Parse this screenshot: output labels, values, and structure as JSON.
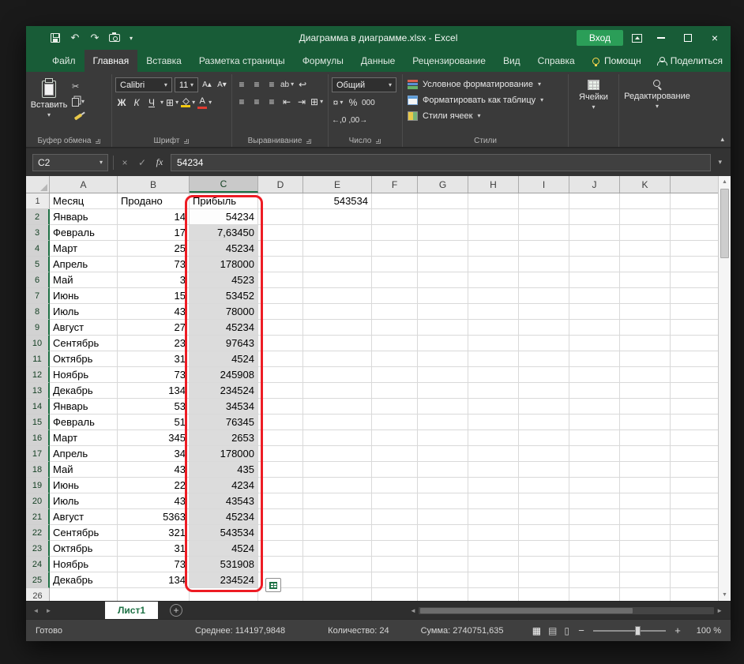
{
  "window": {
    "title": "Диаграмма в диаграмме.xlsx  -  Excel",
    "sign_in": "Вход"
  },
  "tabs": [
    {
      "label": "Файл",
      "active": false
    },
    {
      "label": "Главная",
      "active": true
    },
    {
      "label": "Вставка",
      "active": false
    },
    {
      "label": "Разметка страницы",
      "active": false
    },
    {
      "label": "Формулы",
      "active": false
    },
    {
      "label": "Данные",
      "active": false
    },
    {
      "label": "Рецензирование",
      "active": false
    },
    {
      "label": "Вид",
      "active": false
    },
    {
      "label": "Справка",
      "active": false
    }
  ],
  "tab_extras": {
    "help": "Помощн",
    "share": "Поделиться"
  },
  "ribbon": {
    "clipboard": {
      "paste_label": "Вставить",
      "label": "Буфер обмена"
    },
    "font": {
      "name": "Calibri",
      "size": "11",
      "bold": "Ж",
      "italic": "К",
      "underline": "Ч",
      "color_letter": "А",
      "label": "Шрифт"
    },
    "alignment": {
      "label": "Выравнивание"
    },
    "number": {
      "format": "Общий",
      "label": "Число"
    },
    "styles": {
      "items": [
        "Условное форматирование",
        "Форматировать как таблицу",
        "Стили ячеек"
      ],
      "label": "Стили"
    },
    "cells": {
      "label": "Ячейки"
    },
    "editing": {
      "label": "Редактирование"
    }
  },
  "formula_bar": {
    "name_box": "C2",
    "value": "54234",
    "fx": "fx"
  },
  "grid": {
    "columns": [
      "A",
      "B",
      "C",
      "D",
      "E",
      "F",
      "G",
      "H",
      "I",
      "J",
      "K"
    ],
    "selected_column": "C",
    "active_cell": "C2",
    "selection": {
      "range_col": "C",
      "from_row": 2,
      "to_row": 25
    },
    "rows": [
      {
        "n": "1",
        "A": "Месяц",
        "B": "Продано",
        "C": "Прибыль",
        "E": "543534"
      },
      {
        "n": "2",
        "A": "Январь",
        "B": "14",
        "C": "54234"
      },
      {
        "n": "3",
        "A": "Февраль",
        "B": "17",
        "C": "7,63450"
      },
      {
        "n": "4",
        "A": "Март",
        "B": "25",
        "C": "45234"
      },
      {
        "n": "5",
        "A": "Апрель",
        "B": "73",
        "C": "178000"
      },
      {
        "n": "6",
        "A": "Май",
        "B": "3",
        "C": "4523"
      },
      {
        "n": "7",
        "A": "Июнь",
        "B": "15",
        "C": "53452"
      },
      {
        "n": "8",
        "A": "Июль",
        "B": "43",
        "C": "78000"
      },
      {
        "n": "9",
        "A": "Август",
        "B": "27",
        "C": "45234"
      },
      {
        "n": "10",
        "A": "Сентябрь",
        "B": "23",
        "C": "97643"
      },
      {
        "n": "11",
        "A": "Октябрь",
        "B": "31",
        "C": "4524"
      },
      {
        "n": "12",
        "A": "Ноябрь",
        "B": "73",
        "C": "245908"
      },
      {
        "n": "13",
        "A": "Декабрь",
        "B": "134",
        "C": "234524"
      },
      {
        "n": "14",
        "A": "Январь",
        "B": "53",
        "C": "34534"
      },
      {
        "n": "15",
        "A": "Февраль",
        "B": "51",
        "C": "76345"
      },
      {
        "n": "16",
        "A": "Март",
        "B": "345",
        "C": "2653"
      },
      {
        "n": "17",
        "A": "Апрель",
        "B": "34",
        "C": "178000"
      },
      {
        "n": "18",
        "A": "Май",
        "B": "43",
        "C": "435"
      },
      {
        "n": "19",
        "A": "Июнь",
        "B": "22",
        "C": "4234"
      },
      {
        "n": "20",
        "A": "Июль",
        "B": "43",
        "C": "43543"
      },
      {
        "n": "21",
        "A": "Август",
        "B": "5363",
        "C": "45234"
      },
      {
        "n": "22",
        "A": "Сентябрь",
        "B": "321",
        "C": "543534"
      },
      {
        "n": "23",
        "A": "Октябрь",
        "B": "31",
        "C": "4524"
      },
      {
        "n": "24",
        "A": "Ноябрь",
        "B": "73",
        "C": "531908"
      },
      {
        "n": "25",
        "A": "Декабрь",
        "B": "134",
        "C": "234524"
      },
      {
        "n": "26"
      }
    ]
  },
  "sheet_bar": {
    "sheets": [
      {
        "name": "Лист1",
        "active": true
      }
    ],
    "add": "+"
  },
  "status_bar": {
    "mode": "Готово",
    "average": "Среднее: 114197,9848",
    "count": "Количество: 24",
    "sum": "Сумма: 2740751,635",
    "zoom": "100 %"
  },
  "icons": {
    "dropdown": "▾",
    "up": "▲",
    "down": "▼",
    "left": "◄",
    "right": "►",
    "undo": "↶",
    "redo": "↷",
    "close": "×",
    "scissors": "✂",
    "borders": "⊞",
    "merge": "⊞",
    "wrap": "↩",
    "align_lines": "≡",
    "indent_left": "⇤",
    "indent_right": "⇥",
    "orientation": "ab",
    "font_grow": "А▴",
    "font_shrink": "А▾",
    "currency": "¤",
    "percent": "%",
    "thousands": "000",
    "dec_increase": "←,0",
    "dec_decrease": ",00→",
    "cancel": "×",
    "enter": "✓",
    "view_normal": "▦",
    "view_layout": "▤",
    "view_break": "▯",
    "zoom_out": "−",
    "zoom_in": "+",
    "collapse_ribbon": "▴"
  },
  "colors": {
    "excel_green": "#185C37",
    "signin_green": "#2B9E58",
    "annotation_red": "#ED1C24",
    "selection_fill": "#DCDCDC",
    "selected_header_accent": "#1E7145"
  }
}
